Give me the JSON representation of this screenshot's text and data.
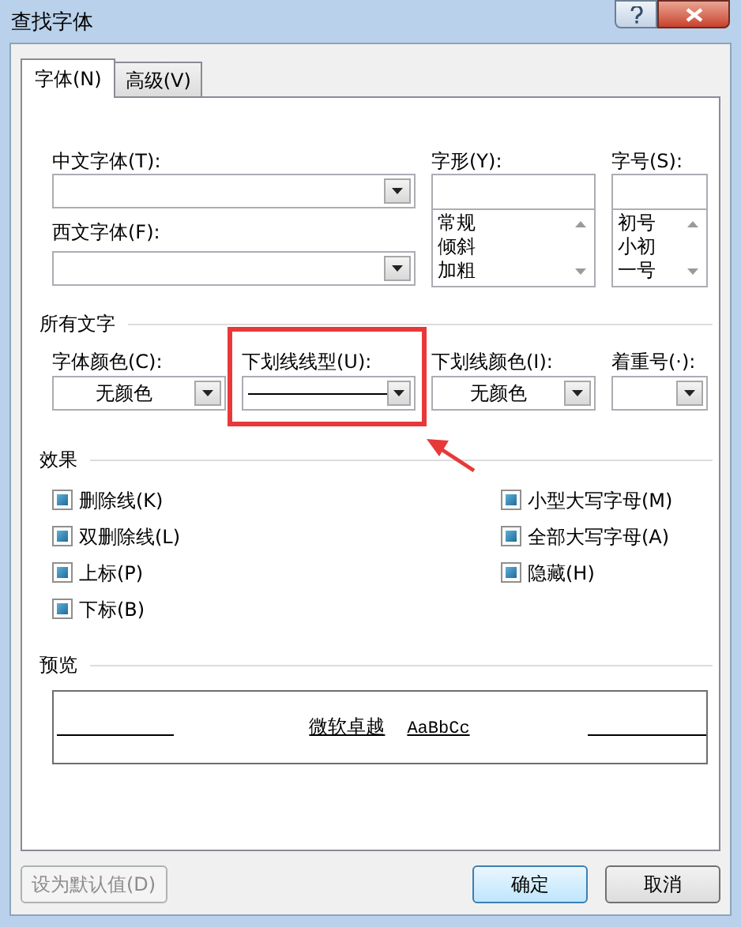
{
  "window": {
    "title": "查找字体"
  },
  "tabs": [
    {
      "label": "字体(N)",
      "selected": true
    },
    {
      "label": "高级(V)",
      "selected": false
    }
  ],
  "font_section": {
    "chinese_font": {
      "label": "中文字体(T):"
    },
    "style": {
      "label": "字形(Y):",
      "options": [
        "常规",
        "倾斜",
        "加粗"
      ]
    },
    "size": {
      "label": "字号(S):",
      "options": [
        "初号",
        "小初",
        "一号"
      ]
    },
    "western_font": {
      "label": "西文字体(F):"
    }
  },
  "all_text": {
    "title": "所有文字",
    "fields": [
      {
        "label": "字体颜色(C):",
        "kind": "text",
        "value": "无颜色",
        "highlighted": false
      },
      {
        "label": "下划线线型(U):",
        "kind": "line",
        "highlighted": true
      },
      {
        "label": "下划线颜色(I):",
        "kind": "text",
        "value": "无颜色",
        "highlighted": false
      },
      {
        "label": "着重号(·):",
        "kind": "empty",
        "highlighted": false
      }
    ]
  },
  "effects": {
    "title": "效果",
    "options": [
      {
        "label": "删除线(K)",
        "indeterminate": true
      },
      {
        "label": "双删除线(L)",
        "indeterminate": true
      },
      {
        "label": "上标(P)",
        "indeterminate": true
      },
      {
        "label": "下标(B)",
        "indeterminate": true
      },
      {
        "label": "小型大写字母(M)",
        "indeterminate": true
      },
      {
        "label": "全部大写字母(A)",
        "indeterminate": true
      },
      {
        "label": "隐藏(H)",
        "indeterminate": true
      }
    ]
  },
  "preview": {
    "title": "预览",
    "sample_cjk": "微软卓越",
    "sample_latin": "AaBbCc"
  },
  "buttons": [
    {
      "label": "设为默认值(D)",
      "disabled": true,
      "default": false
    },
    {
      "label": "确定",
      "disabled": false,
      "default": true
    },
    {
      "label": "取消",
      "disabled": false,
      "default": false
    }
  ]
}
